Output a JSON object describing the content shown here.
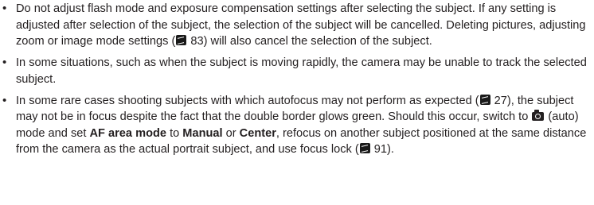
{
  "bullets": [
    {
      "text_a": "Do not adjust flash mode and exposure compensation settings after selecting the subject. If any setting is adjusted after selection of the subject, the selection of the subject will be cancelled. Deleting pictures, adjusting zoom or image mode settings (",
      "ref_a": "83",
      "text_b": ") will also cancel the selection of the subject."
    },
    {
      "text_a": "In some situations, such as when the subject is moving rapidly, the camera may be unable to track the selected subject."
    },
    {
      "text_a": "In some rare cases shooting subjects with which autofocus may not perform as expected (",
      "ref_a": "27",
      "text_b": "), the subject may not be in focus despite the fact that the double border glows green. Should this occur, switch to ",
      "text_c": " (auto) mode and set ",
      "bold_a": "AF area mode",
      "text_d": " to ",
      "bold_b": "Manual",
      "text_e": " or ",
      "bold_c": "Center",
      "text_f": ", refocus on another subject positioned at the same distance from the camera as the actual portrait subject, and use focus lock (",
      "ref_b": "91",
      "text_g": ")."
    }
  ],
  "icons": {
    "reference": "page-reference-icon",
    "camera": "auto-mode-camera-icon"
  }
}
